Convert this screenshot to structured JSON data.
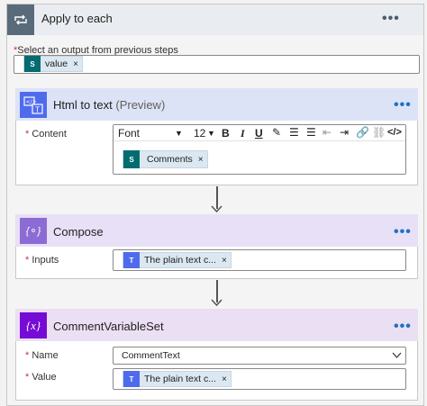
{
  "loop": {
    "title": "Apply to each",
    "more": "•••",
    "select_label": "Select an output from previous steps",
    "token": "value",
    "token_x": "×"
  },
  "html_to_text": {
    "title": "Html to text",
    "suffix": "(Preview)",
    "more": "•••",
    "content_label": "Content",
    "font": "Font",
    "font_size": "12",
    "token": "Comments",
    "token_x": "×"
  },
  "compose": {
    "title": "Compose",
    "more": "•••",
    "inputs_label": "Inputs",
    "token": "The plain text c...",
    "token_x": "×"
  },
  "comment_var": {
    "title": "CommentVariableSet",
    "more": "•••",
    "name_label": "Name",
    "name_value": "CommentText",
    "value_label": "Value",
    "token": "The plain text c...",
    "token_x": "×"
  },
  "required_mark": "*",
  "colors": {
    "loop_header": "#e9edf1",
    "loop_icon": "#596b7a",
    "html_header": "#dde3f7",
    "html_icon": "#4f6bed",
    "compose_header": "#e7e0f7",
    "compose_icon": "#8c6cd4",
    "var_header": "#ebdff3",
    "var_icon": "#770bd6",
    "token_bg": "#dbe8f1",
    "sharepoint": "#036c70"
  }
}
